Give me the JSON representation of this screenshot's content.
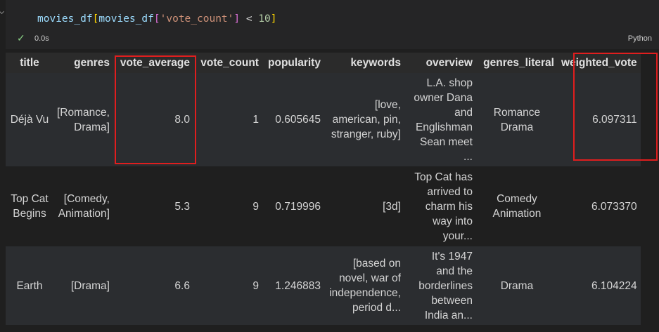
{
  "code": {
    "line": {
      "t1": "movies_df",
      "t2": "[",
      "t3": "movies_df",
      "t4": "[",
      "t5": "'vote_count'",
      "t6": "]",
      "t7": " < ",
      "t8": "10",
      "t9": "]"
    }
  },
  "status": {
    "check": "✓",
    "time": "0.0s",
    "language": "Python"
  },
  "table": {
    "columns": [
      "title",
      "genres",
      "vote_average",
      "vote_count",
      "popularity",
      "keywords",
      "overview",
      "genres_literal",
      "weighted_vote"
    ],
    "rows": [
      {
        "title": [
          "Déjà Vu"
        ],
        "genres": [
          "[Romance,",
          "Drama]"
        ],
        "vote_average": [
          "8.0"
        ],
        "vote_count": [
          "1"
        ],
        "popularity": [
          "0.605645"
        ],
        "keywords": [
          "[love,",
          "american, pin,",
          "stranger, ruby]"
        ],
        "overview": [
          "L.A. shop",
          "owner Dana",
          "and",
          "Englishman",
          "Sean meet",
          "..."
        ],
        "genres_literal": [
          "Romance",
          "Drama"
        ],
        "weighted_vote": [
          "6.097311"
        ]
      },
      {
        "title": [
          "Top Cat",
          "Begins"
        ],
        "genres": [
          "[Comedy,",
          "Animation]"
        ],
        "vote_average": [
          "5.3"
        ],
        "vote_count": [
          "9"
        ],
        "popularity": [
          "0.719996"
        ],
        "keywords": [
          "[3d]"
        ],
        "overview": [
          "Top Cat has",
          "arrived to",
          "charm his",
          "way into",
          "your..."
        ],
        "genres_literal": [
          "Comedy",
          "Animation"
        ],
        "weighted_vote": [
          "6.073370"
        ]
      },
      {
        "title": [
          "Earth"
        ],
        "genres": [
          "[Drama]"
        ],
        "vote_average": [
          "6.6"
        ],
        "vote_count": [
          "9"
        ],
        "popularity": [
          "1.246883"
        ],
        "keywords": [
          "[based on",
          "novel, war of",
          "independence,",
          "period d..."
        ],
        "overview": [
          "It's 1947",
          "and the",
          "borderlines",
          "between",
          "India an..."
        ],
        "genres_literal": [
          "Drama"
        ],
        "weighted_vote": [
          "6.104224"
        ]
      }
    ]
  },
  "colors": {
    "highlight": "#e01e1e",
    "success": "#89d185",
    "background": "#1f1f1f"
  }
}
